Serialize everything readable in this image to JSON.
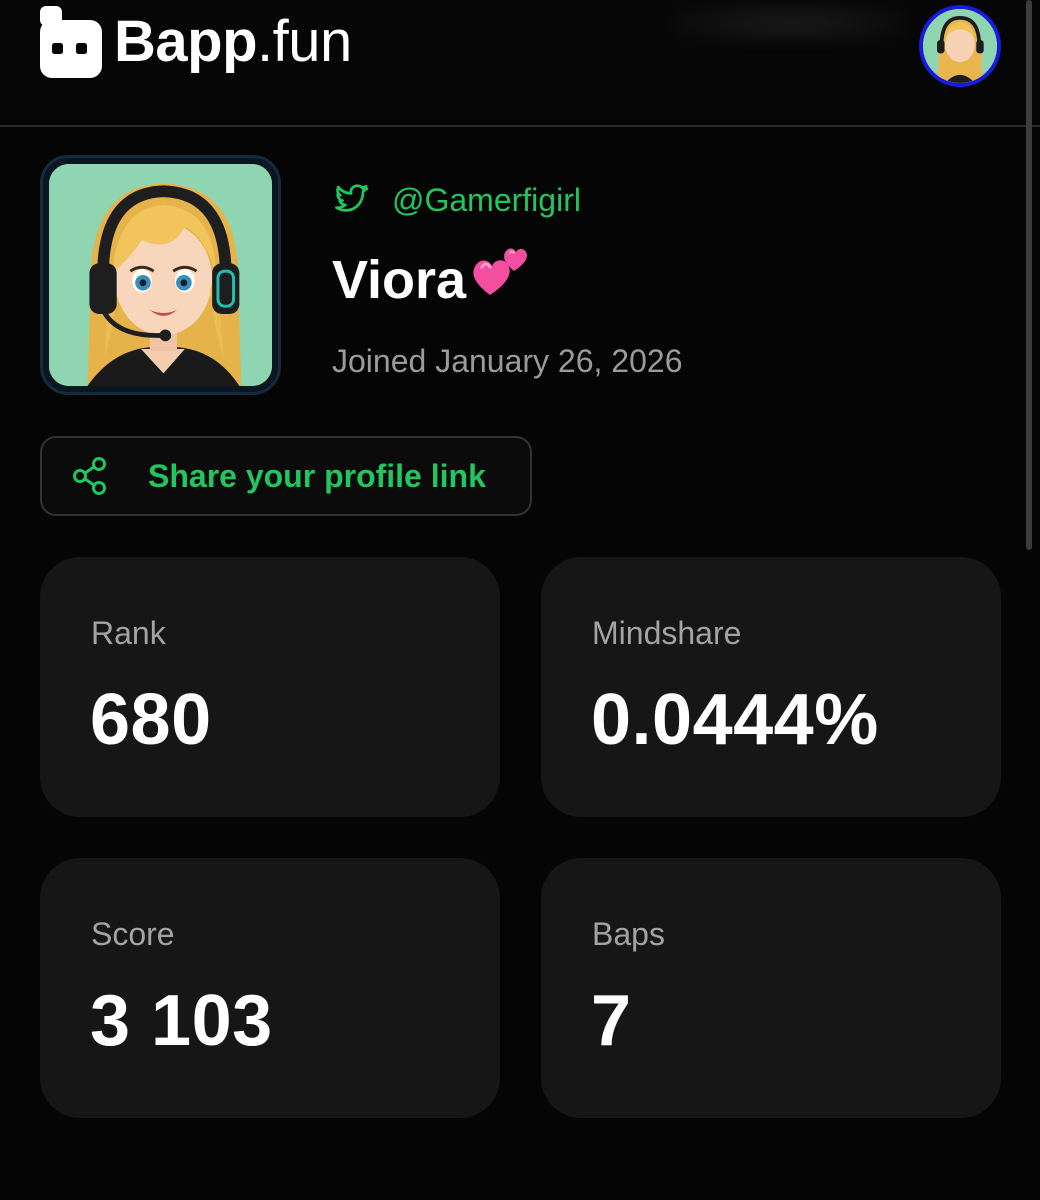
{
  "header": {
    "logo_bold": "Bapp",
    "logo_light": ".fun"
  },
  "profile": {
    "twitter_handle": "@Gamerfigirl",
    "display_name": "Viora",
    "name_emoji": "two-hearts",
    "joined": "Joined January 26, 2026"
  },
  "share": {
    "label": "Share your profile link"
  },
  "stats": [
    {
      "label": "Rank",
      "value": "680"
    },
    {
      "label": "Mindshare",
      "value": "0.0444%"
    },
    {
      "label": "Score",
      "value": "3 103"
    },
    {
      "label": "Baps",
      "value": "7"
    }
  ],
  "colors": {
    "background": "#050505",
    "accent_green": "#22c55e",
    "card": "#161616",
    "muted_text": "#9a9a9a",
    "avatar_ring": "#1a1adc"
  },
  "icons": {
    "logo": "bapp-logo-icon",
    "twitter": "twitter-icon",
    "share": "share-icon",
    "emoji": "two-hearts-emoji"
  }
}
